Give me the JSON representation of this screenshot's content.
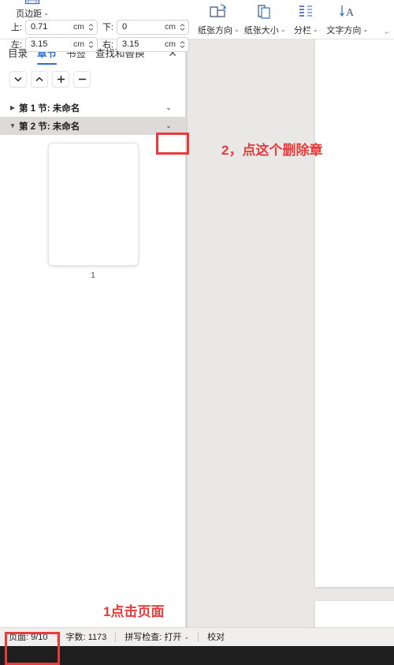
{
  "ribbon": {
    "margins": {
      "icon": "page-margins-icon",
      "caption": "页边距",
      "fields": [
        {
          "label": "上:",
          "value": "0.71",
          "unit": "cm",
          "name": "margin-top"
        },
        {
          "label": "下:",
          "value": "0",
          "unit": "cm",
          "name": "margin-bottom"
        },
        {
          "label": "左:",
          "value": "3.15",
          "unit": "cm",
          "name": "margin-left"
        },
        {
          "label": "右:",
          "value": "3.15",
          "unit": "cm",
          "name": "margin-right"
        }
      ]
    },
    "buttons": [
      {
        "caption": "纸张方向",
        "icon": "page-orientation-icon",
        "caret": "⌄"
      },
      {
        "caption": "纸张大小",
        "icon": "page-size-icon",
        "caret": "⌄"
      },
      {
        "caption": "分栏",
        "icon": "columns-icon",
        "caret": "⌄"
      },
      {
        "caption": "文字方向",
        "icon": "text-direction-icon",
        "caret": "⌄"
      }
    ],
    "expand_label": "⌐"
  },
  "panel": {
    "tabs": [
      {
        "label": "目录",
        "active": false
      },
      {
        "label": "章节",
        "active": true
      },
      {
        "label": "书签",
        "active": false
      },
      {
        "label": "查找和替换",
        "active": false
      }
    ],
    "close_label": "✕",
    "toolbar_buttons": [
      {
        "name": "move-down-button",
        "icon": "chevron-down-icon"
      },
      {
        "name": "move-up-button",
        "icon": "chevron-up-icon"
      },
      {
        "name": "add-section-button",
        "icon": "plus-icon"
      },
      {
        "name": "remove-section-button",
        "icon": "minus-icon"
      }
    ],
    "sections": [
      {
        "label": "第 1 节: 未命名",
        "expanded": false,
        "selected": false,
        "triangle": "▶",
        "chevron": "⌄"
      },
      {
        "label": "第 2 节: 未命名",
        "expanded": true,
        "selected": true,
        "triangle": "▼",
        "chevron": "⌄"
      }
    ],
    "thumbnail": {
      "page_number": "1"
    }
  },
  "statusbar": {
    "items": [
      {
        "label": "页面: 9/10",
        "name": "page-count-status",
        "caret": ""
      },
      {
        "label": "字数: 1173",
        "name": "word-count-status",
        "caret": ""
      },
      {
        "label": "拼写检查: 打开",
        "name": "spell-check-status",
        "caret": "⌄"
      },
      {
        "label": "校对",
        "name": "proofread-status",
        "caret": ""
      }
    ]
  },
  "annotations": {
    "delete_section": "2，点这个删除章",
    "click_page": "1点击页面",
    "accent_color": "#ea3b3b"
  }
}
